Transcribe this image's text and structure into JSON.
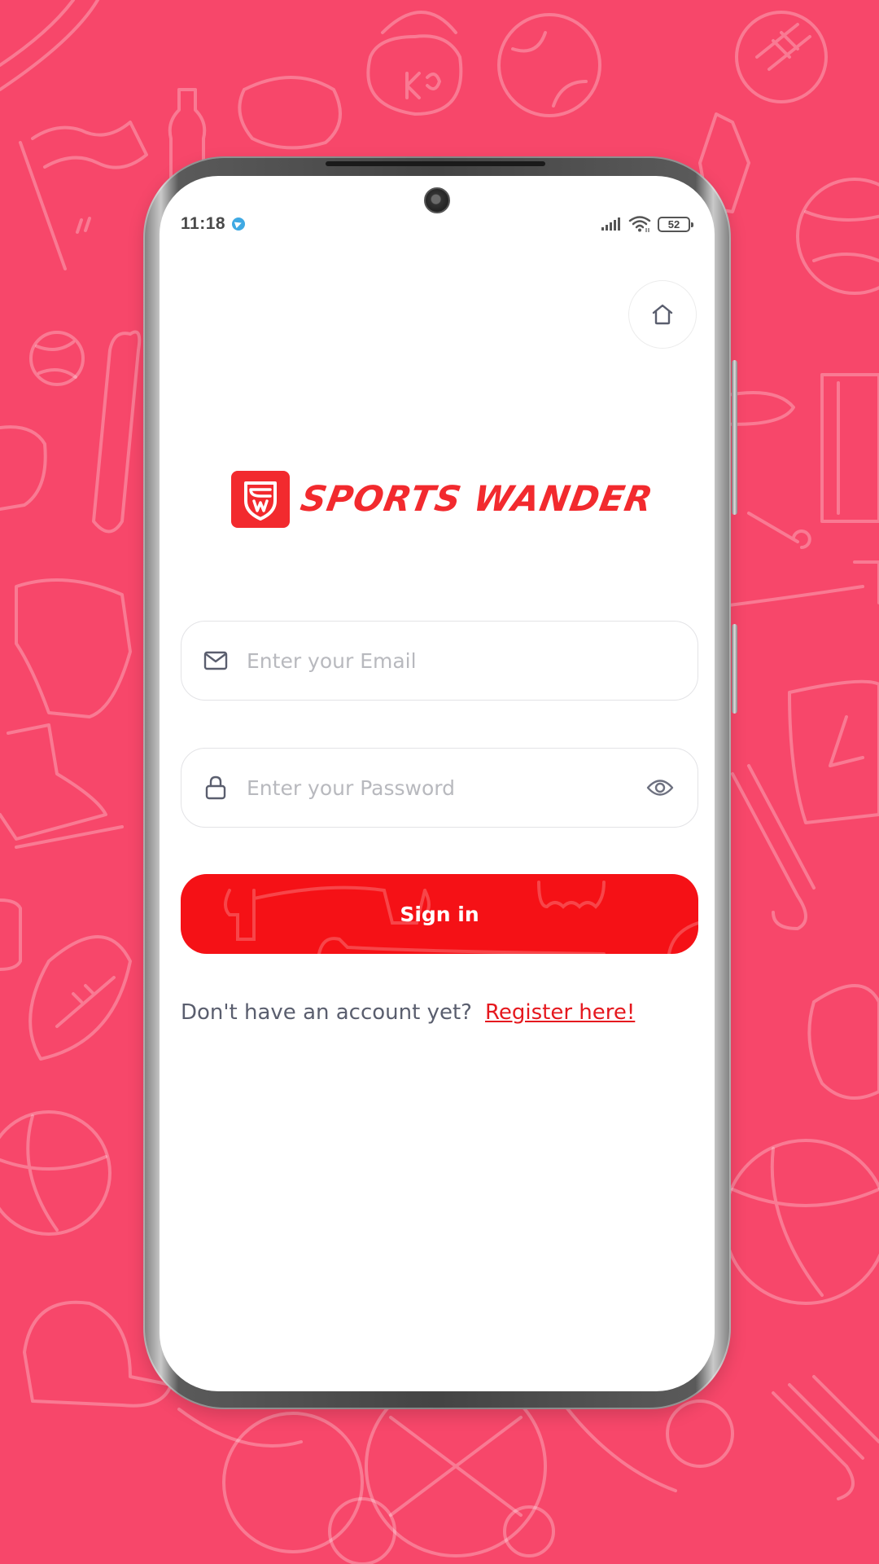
{
  "status_bar": {
    "time": "11:18",
    "notification_icon": "telegram-icon",
    "signal_icon": "cellular-signal-icon",
    "wifi_icon": "wifi-icon",
    "battery_level": "52"
  },
  "header": {
    "home_icon": "home-icon"
  },
  "logo": {
    "brand_name": "SPORTS WANDER",
    "badge_icon": "shield-sw-icon"
  },
  "form": {
    "email": {
      "icon": "mail-icon",
      "placeholder": "Enter your Email",
      "value": ""
    },
    "password": {
      "icon": "lock-icon",
      "placeholder": "Enter your Password",
      "value": "",
      "toggle_icon": "eye-icon"
    },
    "submit_label": "Sign in"
  },
  "footer": {
    "prompt": "Don't have an account yet?",
    "register_link": "Register here!"
  },
  "colors": {
    "background": "#F7476A",
    "brand_red": "#F22A2E",
    "button_red": "#F51116",
    "link_red": "#E5181E",
    "text_muted": "#5A5E6E",
    "placeholder": "#B8B9BE"
  }
}
